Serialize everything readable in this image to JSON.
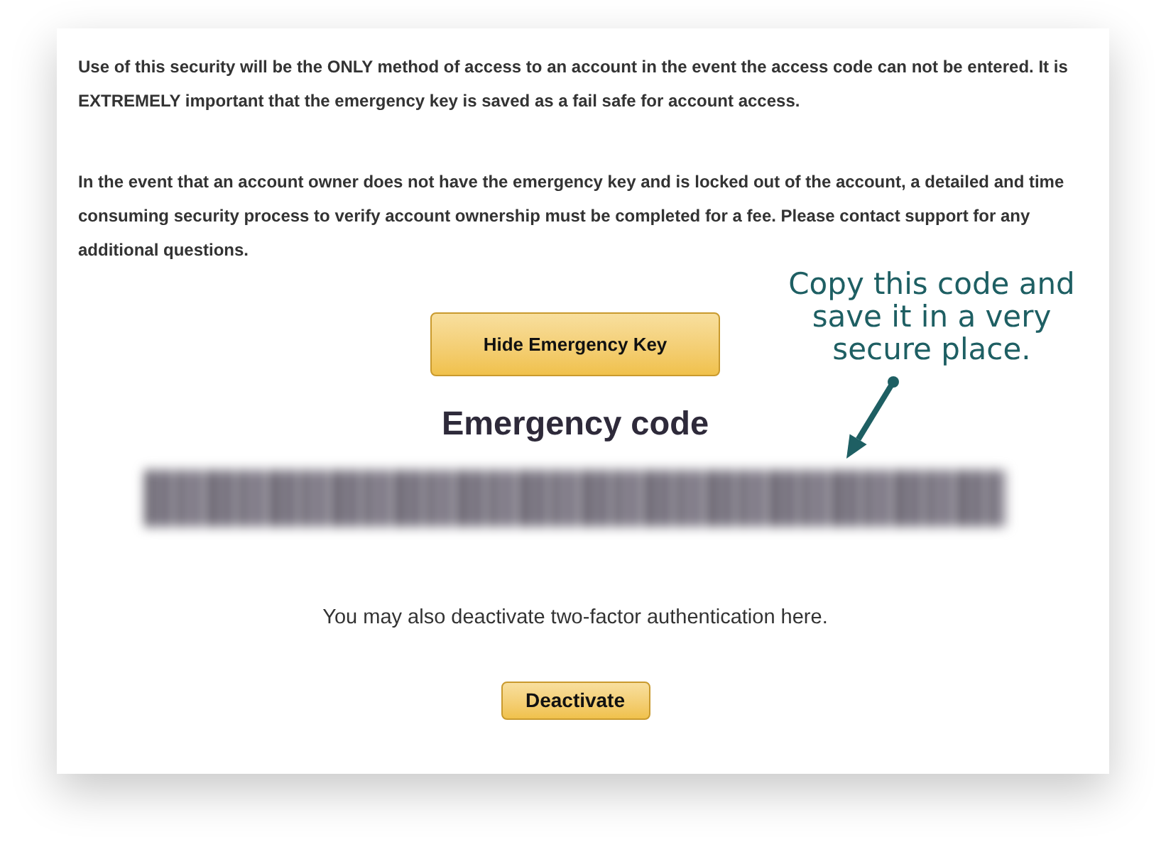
{
  "paragraphs": [
    "Use of this security will be the ONLY method of access to an account in the event the access code can not be entered. It is EXTREMELY important that the emergency key is saved as a fail safe for account access.",
    "In the event that an account owner does not have the emergency key and is locked out of the account, a detailed and time consuming security process to verify account ownership must be completed for a fee. Please contact support for any additional questions."
  ],
  "annotation": {
    "text": "Copy this code and\nsave it in a very\nsecure place."
  },
  "hide_button": {
    "label": "Hide Emergency Key"
  },
  "code_heading": "Emergency code",
  "deactivate_note": "You may also deactivate two-factor authentication here.",
  "deactivate_button": {
    "label": "Deactivate"
  }
}
